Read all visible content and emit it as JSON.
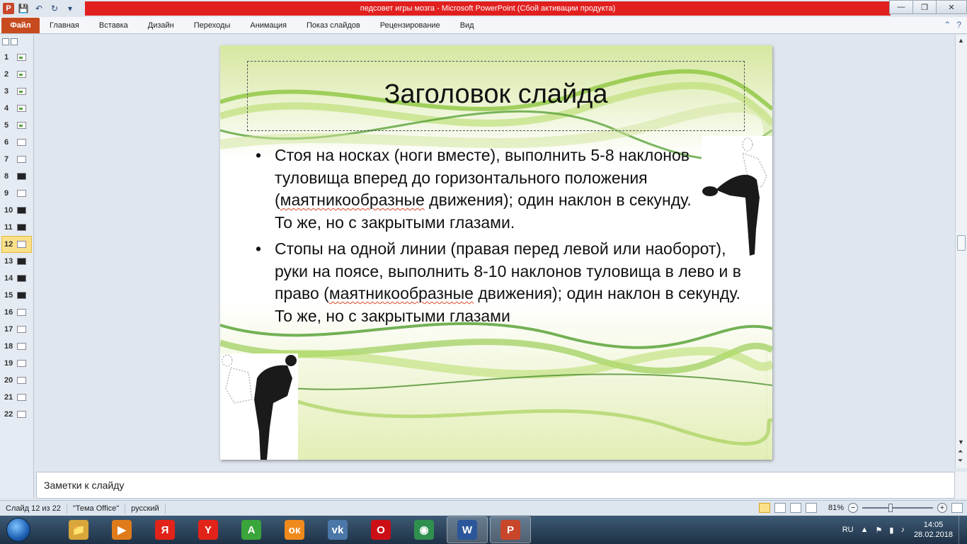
{
  "window": {
    "title": "педсовет игры мозга  -  Microsoft PowerPoint (Сбой активации продукта)",
    "app_icon_label": "P",
    "minimize": "—",
    "maximize": "❐",
    "close": "✕"
  },
  "qat": {
    "save": "💾",
    "undo": "↶",
    "redo": "↻",
    "customize": "▾"
  },
  "ribbon": {
    "file_tab": "Файл",
    "tabs": [
      "Главная",
      "Вставка",
      "Дизайн",
      "Переходы",
      "Анимация",
      "Показ слайдов",
      "Рецензирование",
      "Вид"
    ],
    "help_icon": "?"
  },
  "thumbnails": {
    "items": [
      {
        "num": "1",
        "style": "green"
      },
      {
        "num": "2",
        "style": "green"
      },
      {
        "num": "3",
        "style": "green"
      },
      {
        "num": "4",
        "style": "green"
      },
      {
        "num": "5",
        "style": "green"
      },
      {
        "num": "6",
        "style": "plain"
      },
      {
        "num": "7",
        "style": "plain"
      },
      {
        "num": "8",
        "style": "dark"
      },
      {
        "num": "9",
        "style": "plain"
      },
      {
        "num": "10",
        "style": "dark"
      },
      {
        "num": "11",
        "style": "dark"
      },
      {
        "num": "12",
        "style": "plain"
      },
      {
        "num": "13",
        "style": "dark"
      },
      {
        "num": "14",
        "style": "dark"
      },
      {
        "num": "15",
        "style": "dark"
      },
      {
        "num": "16",
        "style": "plain"
      },
      {
        "num": "17",
        "style": "plain"
      },
      {
        "num": "18",
        "style": "plain"
      },
      {
        "num": "19",
        "style": "plain"
      },
      {
        "num": "20",
        "style": "plain"
      },
      {
        "num": "21",
        "style": "plain"
      },
      {
        "num": "22",
        "style": "plain"
      }
    ],
    "active": "12"
  },
  "slide": {
    "title": "Заголовок слайда",
    "bullet1_a": "Стоя на носках (ноги вместе), выполнить 5-8 наклонов туловища вперед до горизонтального положения (",
    "bullet1_spell": "маятникообразные",
    "bullet1_b": " движения); один наклон в секунду.",
    "bullet1_line2": "То же, но с закрытыми глазами.",
    "bullet2_a": "Стопы на одной линии (правая перед левой или наоборот), руки на поясе, выполнить 8-10 наклонов туловища в лево и в право (",
    "bullet2_spell": "маятникообразные",
    "bullet2_b": " движения); один наклон в секунду.",
    "bullet2_line2": "То же, но с закрытыми глазами"
  },
  "notes": {
    "placeholder": "Заметки к слайду"
  },
  "status": {
    "slide_info": "Слайд 12 из 22",
    "theme": "\"Тема Office\"",
    "language": "русский",
    "zoom": "81%",
    "zoom_level": 0.81
  },
  "taskbar": {
    "apps": [
      {
        "name": "explorer",
        "glyph": "📁",
        "color": "#d8a63a"
      },
      {
        "name": "media",
        "glyph": "▶",
        "color": "#e07b1c"
      },
      {
        "name": "yandex",
        "glyph": "Я",
        "color": "#e2231a"
      },
      {
        "name": "yandex-browser",
        "glyph": "Y",
        "color": "#e2231a"
      },
      {
        "name": "adguard",
        "glyph": "A",
        "color": "#3aa53a"
      },
      {
        "name": "odnoklassniki",
        "glyph": "ок",
        "color": "#f08a1c"
      },
      {
        "name": "vk",
        "glyph": "vk",
        "color": "#4a76a8"
      },
      {
        "name": "opera",
        "glyph": "O",
        "color": "#cc0f16"
      },
      {
        "name": "chrome",
        "glyph": "◉",
        "color": "#2f8f4f"
      },
      {
        "name": "word",
        "glyph": "W",
        "color": "#2b579a"
      },
      {
        "name": "powerpoint",
        "glyph": "P",
        "color": "#c8462a"
      }
    ],
    "lang": "RU",
    "time": "14:05",
    "date": "28.02.2018"
  }
}
